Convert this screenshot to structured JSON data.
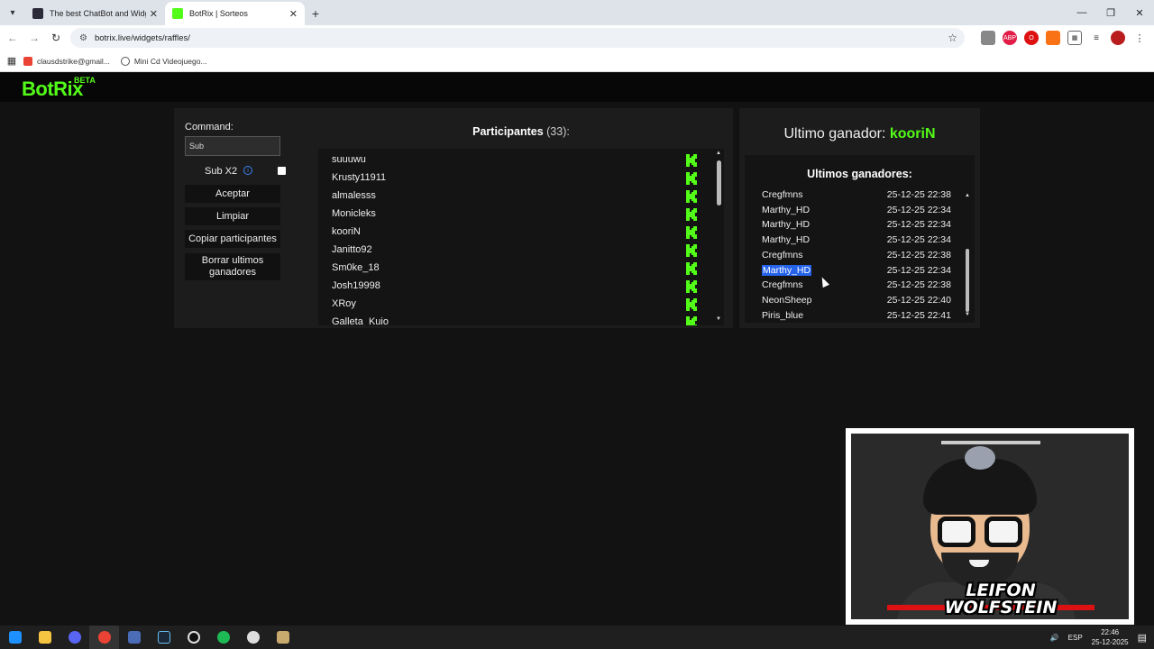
{
  "browser": {
    "tabs": [
      {
        "title": "The best ChatBot and Widgets",
        "active": false,
        "favicon_color": "#2b2b3a"
      },
      {
        "title": "BotRix | Sorteos",
        "active": true,
        "favicon_color": "#53fc18"
      }
    ],
    "url": "botrix.live/widgets/raffles/",
    "bookmarks": [
      {
        "label": "clausdstrike@gmail...",
        "icon": "gmail-icon"
      },
      {
        "label": "Mini Cd Videojuego...",
        "icon": "globe-icon"
      }
    ]
  },
  "site": {
    "logo": "BotRix",
    "badge": "BETA"
  },
  "controls": {
    "command_label": "Command:",
    "command_value": "Sub",
    "sub_label": "Sub X2",
    "buttons": {
      "accept": "Aceptar",
      "clear": "Limpiar",
      "copy": "Copiar participantes",
      "delete": "Borrar ultimos ganadores"
    }
  },
  "participants": {
    "title": "Participantes",
    "count": "(33):",
    "items": [
      "suuuwu",
      "Krusty11911",
      "almalesss",
      "Monicleks",
      "kooriN",
      "Janitto92",
      "Sm0ke_18",
      "Josh19998",
      "XRoy",
      "Galleta_Kuio"
    ]
  },
  "winner": {
    "label": "Ultimo ganador:",
    "name": "kooriN",
    "history_title": "Ultimos ganadores:",
    "history": [
      {
        "name": "Cregfmns",
        "date": "25-12-25 22:38"
      },
      {
        "name": "Marthy_HD",
        "date": "25-12-25 22:34"
      },
      {
        "name": "Marthy_HD",
        "date": "25-12-25 22:34"
      },
      {
        "name": "Marthy_HD",
        "date": "25-12-25 22:34"
      },
      {
        "name": "Cregfmns",
        "date": "25-12-25 22:38"
      },
      {
        "name": "Marthy_HD",
        "date": "25-12-25 22:34",
        "selected": true
      },
      {
        "name": "Cregfmns",
        "date": "25-12-25 22:38"
      },
      {
        "name": "NeonSheep",
        "date": "25-12-25 22:40"
      },
      {
        "name": "Piris_blue",
        "date": "25-12-25 22:41"
      }
    ]
  },
  "webcam": {
    "name_line1": "LEIFON",
    "name_line2": "WOLFSTEIN"
  },
  "taskbar": {
    "lang": "ESP",
    "time": "22:46",
    "date": "25-12-2025"
  },
  "colors": {
    "accent": "#53fc18",
    "selection": "#2563eb",
    "panel": "#1c1c1c"
  }
}
